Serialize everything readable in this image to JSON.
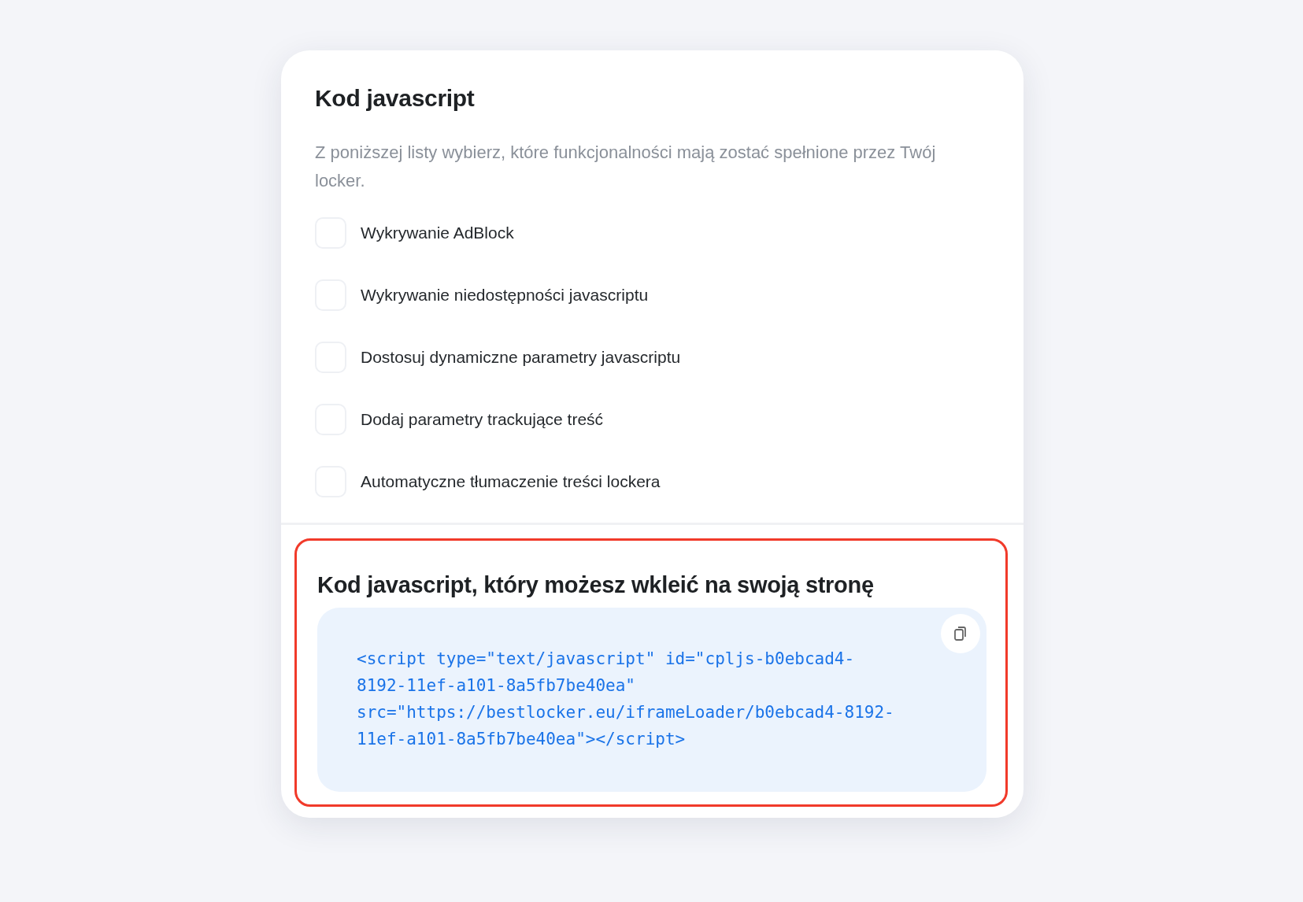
{
  "title": "Kod javascript",
  "description": "Z poniższej listy wybierz, które funkcjonalności mają zostać spełnione przez Twój locker.",
  "options": [
    {
      "label": "Wykrywanie AdBlock",
      "checked": false
    },
    {
      "label": "Wykrywanie niedostępności javascriptu",
      "checked": false
    },
    {
      "label": "Dostosuj dynamiczne parametry javascriptu",
      "checked": false
    },
    {
      "label": "Dodaj parametry trackujące treść",
      "checked": false
    },
    {
      "label": "Automatyczne tłumaczenie treści lockera",
      "checked": false
    }
  ],
  "code_section": {
    "highlighted": true,
    "title": "Kod javascript, który możesz wkleić na swoją stronę",
    "code_lines": [
      "<script type=\"text/javascript\" id=\"cpljs-b0ebcad4-",
      "8192-11ef-a101-8a5fb7be40ea\"",
      "src=\"https://bestlocker.eu/iframeLoader/b0ebcad4-8192-",
      "11ef-a101-8a5fb7be40ea\"></script>"
    ]
  }
}
